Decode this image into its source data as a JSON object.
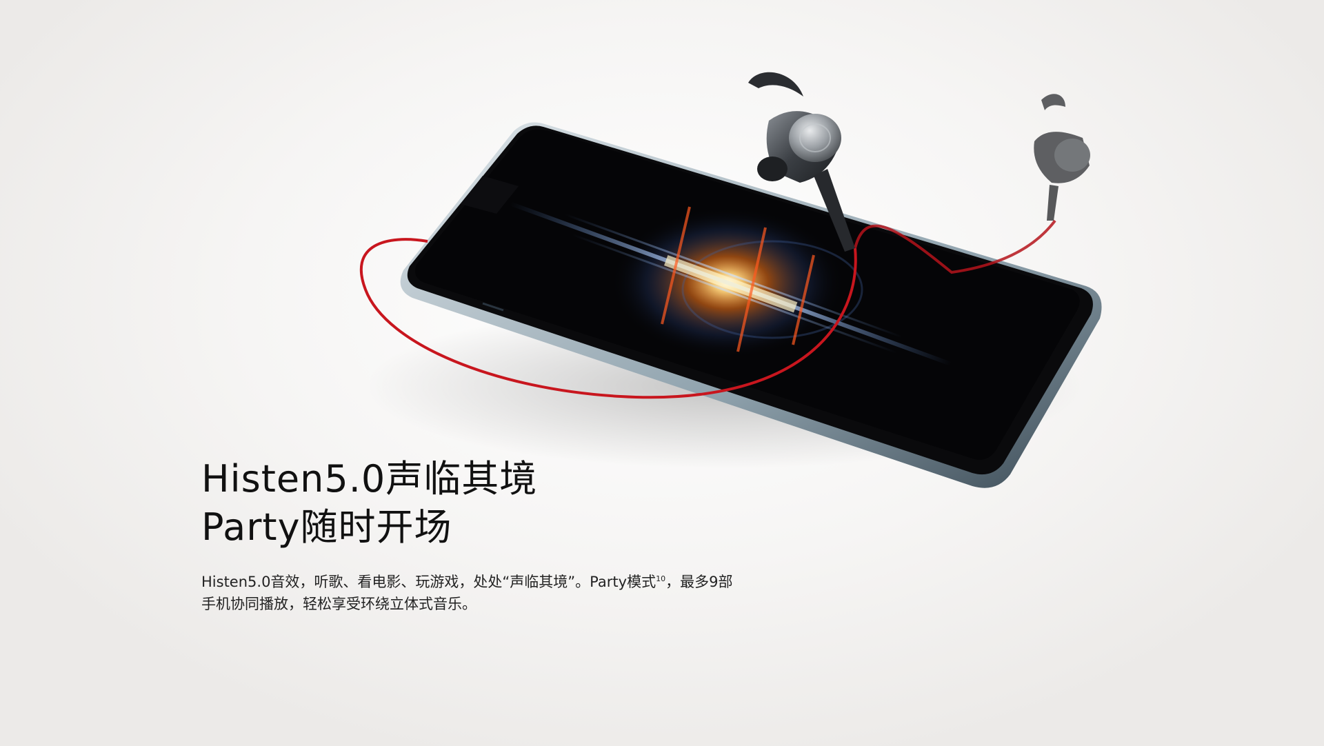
{
  "hero": {
    "headline_line1": "Histen5.0声临其境",
    "headline_line2": "Party随时开场",
    "body_part1": "Histen5.0音效，听歌、看电影、玩游戏，处处“声临其境”。Party模式",
    "footnote_ref": "10",
    "body_part2": "，最多9部",
    "body_line2": "手机协同播放，轻松享受环绕立体式音乐。"
  },
  "illustration": {
    "phone_icon": "smartphone-icon",
    "earphones_icon": "neckband-earphones-icon",
    "screen_art": "audio-light-burst"
  },
  "colors": {
    "cable_red": "#c8161e",
    "background": "#f4f3f2",
    "text": "#111111"
  }
}
